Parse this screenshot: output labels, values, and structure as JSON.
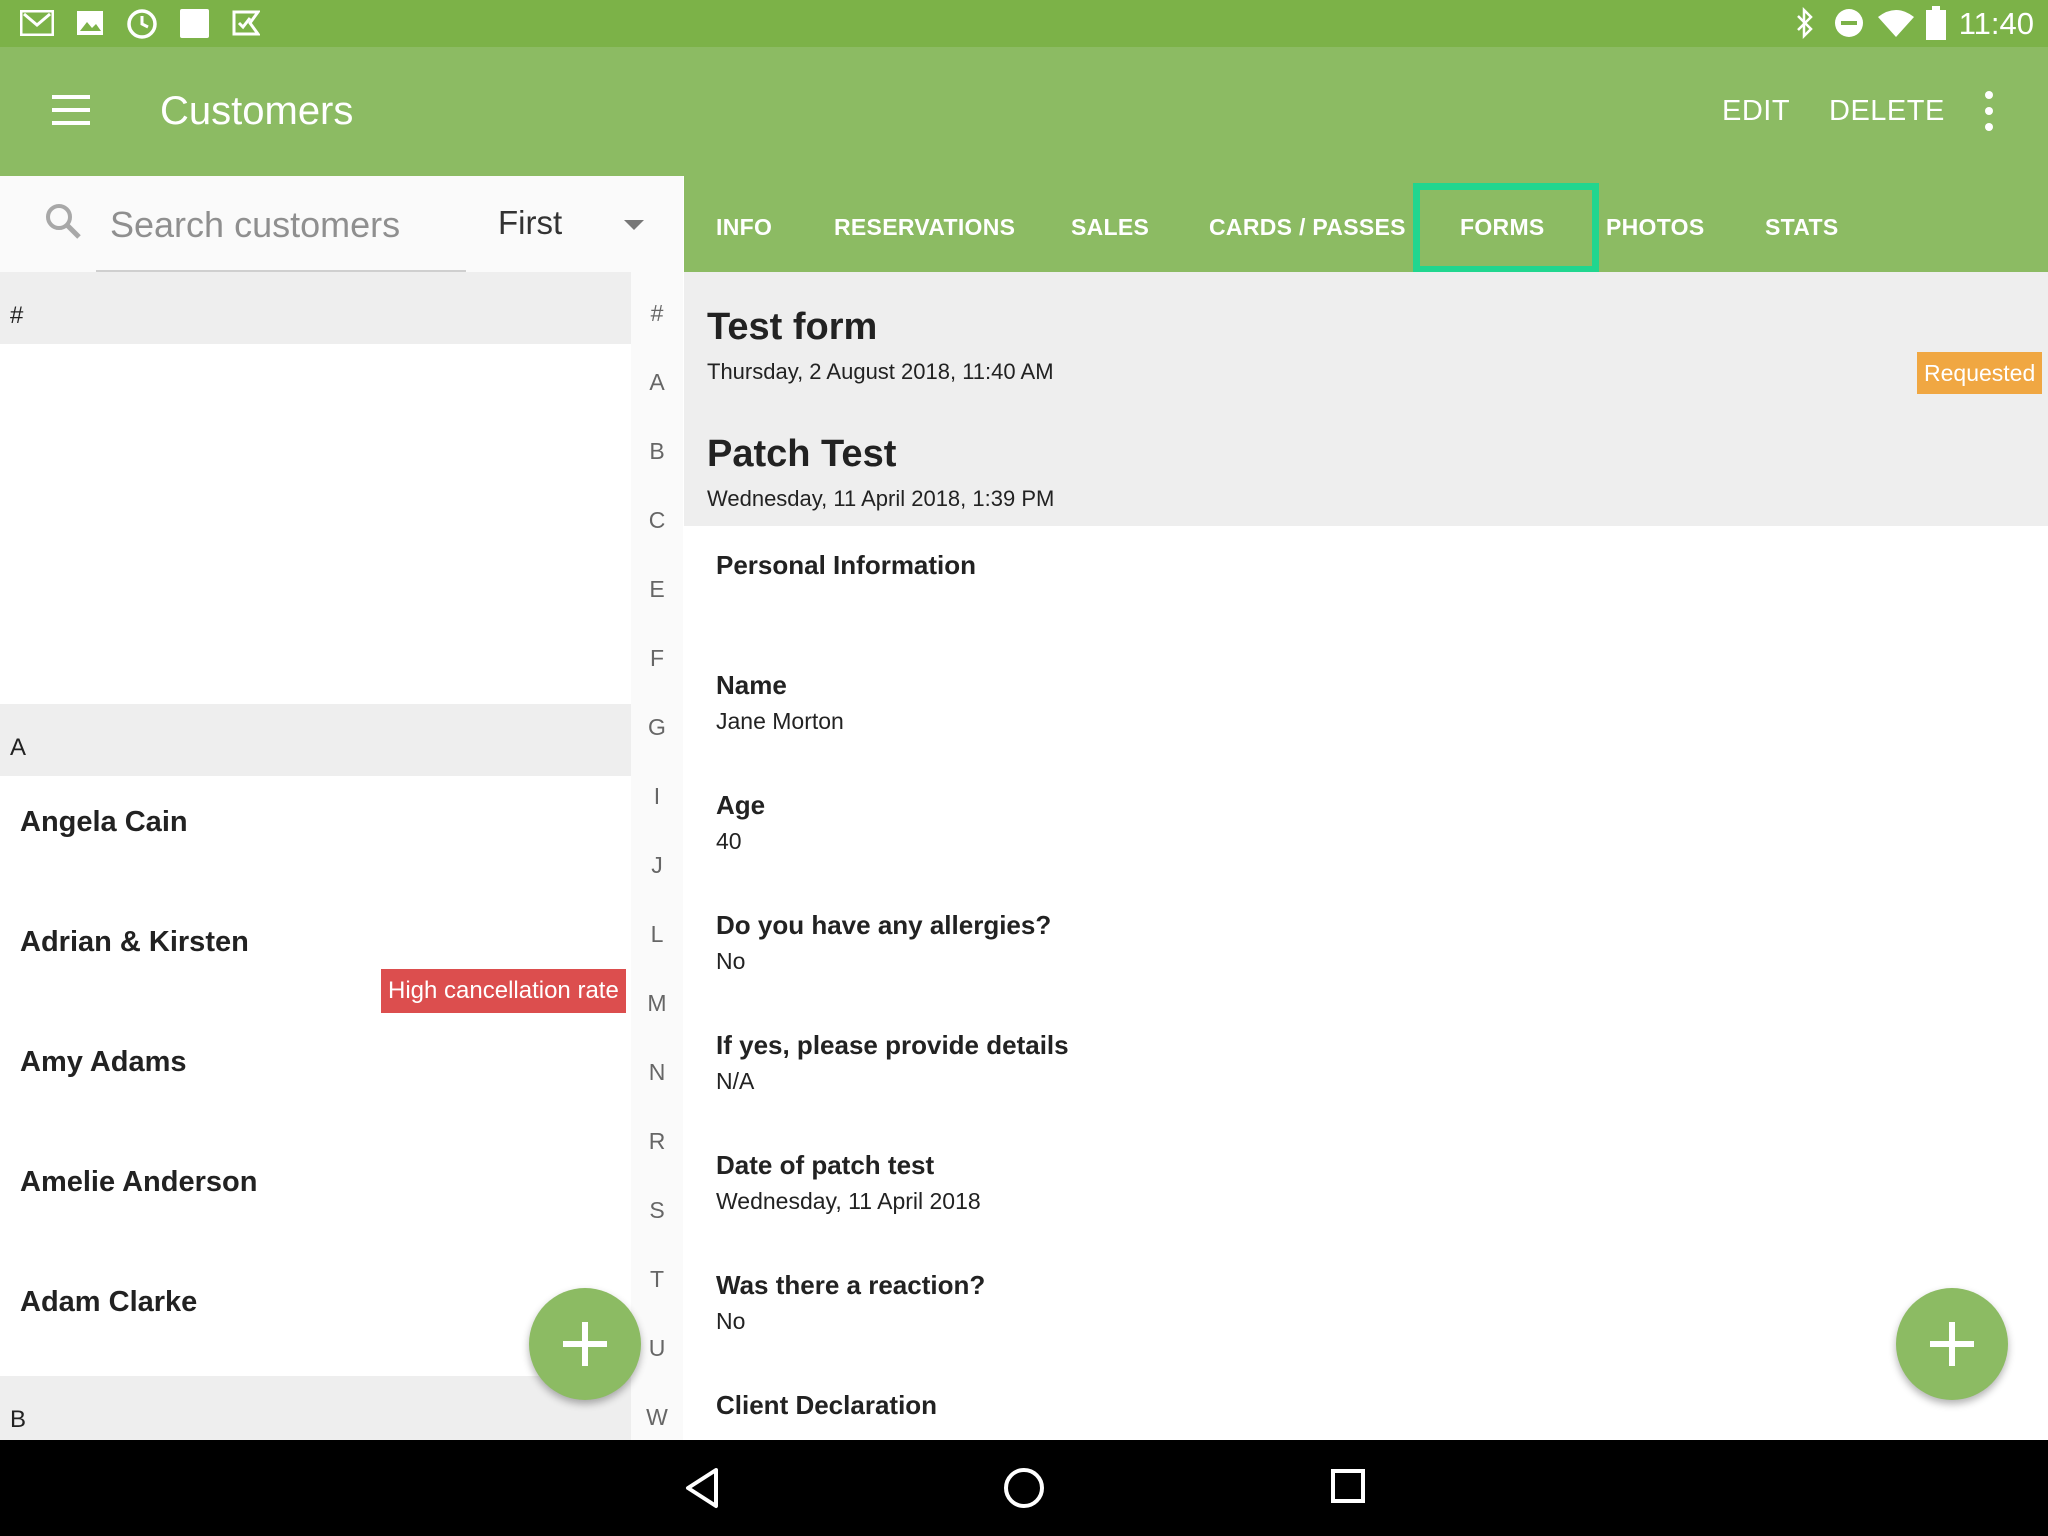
{
  "status_bar": {
    "time": "11:40",
    "left_icons": [
      "gmail-icon",
      "photos-icon",
      "clock-icon",
      "square-icon",
      "tasks-icon"
    ],
    "right_icons": [
      "bluetooth-icon",
      "do-not-disturb-icon",
      "wifi-icon",
      "battery-icon"
    ]
  },
  "app_bar": {
    "title": "Customers",
    "actions": {
      "edit": "EDIT",
      "delete": "DELETE"
    }
  },
  "search": {
    "placeholder": "Search customers",
    "sort_selected": "First"
  },
  "customer_list": {
    "sections": [
      {
        "letter": "#",
        "customers": []
      },
      {
        "letter": "A",
        "customers": [
          {
            "name": "Angela Cain"
          },
          {
            "name": "Adrian & Kirsten",
            "badge": "High cancellation rate"
          },
          {
            "name": "Amy Adams"
          },
          {
            "name": "Amelie Anderson"
          },
          {
            "name": "Adam Clarke"
          }
        ]
      },
      {
        "letter": "B",
        "customers": []
      }
    ]
  },
  "alphabet_index": [
    "#",
    "A",
    "B",
    "C",
    "E",
    "F",
    "G",
    "I",
    "J",
    "L",
    "M",
    "N",
    "R",
    "S",
    "T",
    "U",
    "W"
  ],
  "tabs": [
    "INFO",
    "RESERVATIONS",
    "SALES",
    "CARDS / PASSES",
    "FORMS",
    "PHOTOS",
    "STATS"
  ],
  "active_tab": "FORMS",
  "forms": [
    {
      "title": "Test form",
      "date": "Thursday, 2 August 2018, 11:40 AM",
      "status": "Requested"
    },
    {
      "title": "Patch Test",
      "date": "Wednesday, 11 April 2018, 1:39 PM"
    }
  ],
  "form_detail": {
    "section_title": "Personal Information",
    "fields": [
      {
        "label": "Name",
        "value": "Jane Morton"
      },
      {
        "label": "Age",
        "value": "40"
      },
      {
        "label": "Do you have any allergies?",
        "value": "No"
      },
      {
        "label": "If yes, please provide details",
        "value": "N/A"
      },
      {
        "label": "Date of patch test",
        "value": "Wednesday, 11 April 2018"
      },
      {
        "label": "Was there a reaction?",
        "value": "No"
      }
    ],
    "next_section": "Client Declaration"
  },
  "colors": {
    "status_bar": "#7cb248",
    "app_bar": "#8cbb63",
    "highlight": "#20d68f",
    "cancel_badge": "#dc4e4e",
    "requested_badge": "#f0a742"
  }
}
